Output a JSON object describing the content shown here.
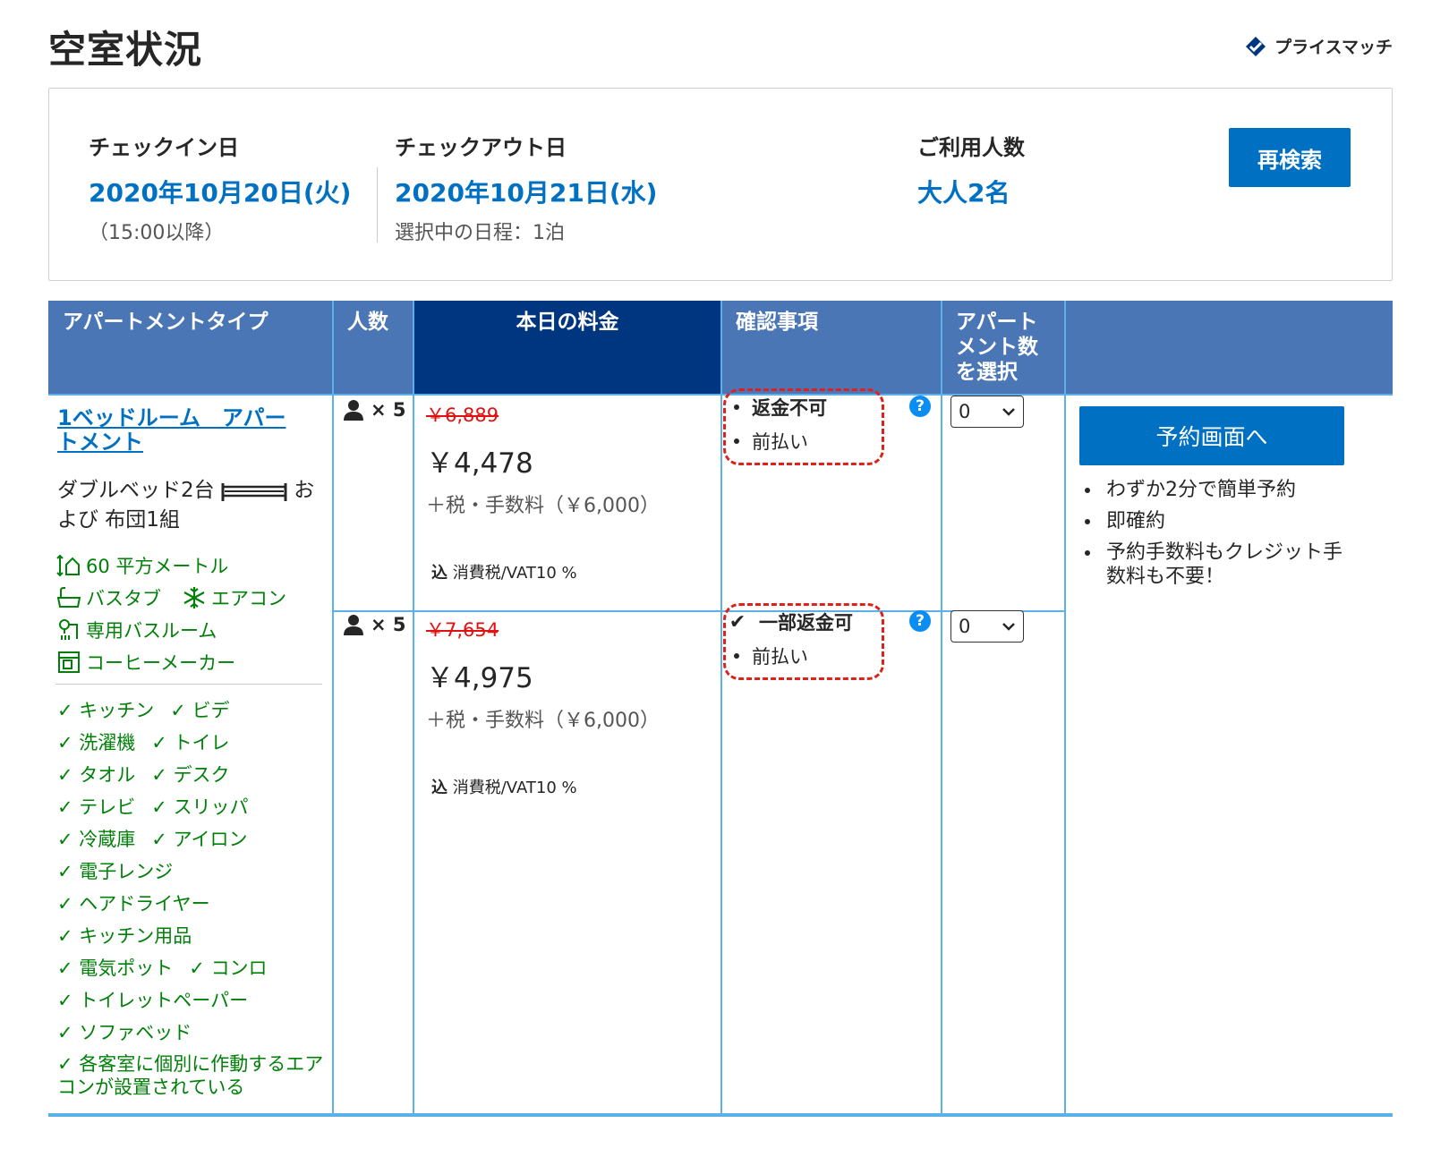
{
  "page_title": "空室状況",
  "price_match_label": "プライスマッチ",
  "search": {
    "checkin_label": "チェックイン日",
    "checkin_date": "2020年10月20日(火)",
    "checkin_note": "（15:00以降）",
    "checkout_label": "チェックアウト日",
    "checkout_date": "2020年10月21日(水)",
    "checkout_note": "選択中の日程：1泊",
    "guests_label": "ご利用人数",
    "guests_value": "大人2名",
    "research_button": "再検索"
  },
  "table_headers": {
    "type": "アパートメントタイプ",
    "guests": "人数",
    "price": "本日の料金",
    "conditions": "確認事項",
    "select_count": "アパートメント数を選択"
  },
  "room": {
    "name": "1ベッドルーム　アパートメント",
    "bed_before": "ダブルベッド2台",
    "bed_after": "および 布団1組",
    "facilities": [
      {
        "label": "60 平方メートル",
        "icon": "room-size-icon"
      },
      {
        "label": "バスタブ",
        "icon": "bathtub-icon"
      },
      {
        "label": "エアコン",
        "icon": "air-conditioning-icon"
      },
      {
        "label": "専用バスルーム",
        "icon": "private-bathroom-icon"
      },
      {
        "label": "コーヒーメーカー",
        "icon": "coffee-maker-icon"
      }
    ],
    "amenities": {
      "row1": [
        "キッチン",
        "ビデ"
      ],
      "row2": [
        "洗濯機",
        "トイレ"
      ],
      "row3": [
        "タオル",
        "デスク"
      ],
      "row4": [
        "テレビ",
        "スリッパ"
      ],
      "row5": [
        "冷蔵庫",
        "アイロン"
      ],
      "row6": [
        "電子レンジ"
      ],
      "row7": [
        "ヘアドライヤー"
      ],
      "row8": [
        "キッチン用品"
      ],
      "row9": [
        "電気ポット",
        "コンロ"
      ],
      "row10": [
        "トイレットペーパー"
      ],
      "row11": [
        "ソファベッド"
      ],
      "row12": [
        "各客室に個別に作動するエアコンが設置されている"
      ]
    }
  },
  "options": [
    {
      "guests": "× 5",
      "old_price": "￥6,889",
      "price": "￥4,478",
      "fee": "＋税・手数料（￥6,000）",
      "tax_prefix": "込",
      "tax": "消費税/VAT10 %",
      "condition1": "返金不可",
      "condition2": "前払い",
      "select_value": "0"
    },
    {
      "guests": "× 5",
      "old_price": "￥7,654",
      "price": "￥4,975",
      "fee": "＋税・手数料（￥6,000）",
      "tax_prefix": "込",
      "tax": "消費税/VAT10 %",
      "condition1": "一部返金可",
      "condition2": "前払い",
      "select_value": "0"
    }
  ],
  "booking": {
    "button": "予約画面へ",
    "benefits": [
      "わずか2分で簡単予約",
      "即確約",
      "予約手数料もクレジット手数料も不要！"
    ]
  },
  "colors": {
    "brand_blue": "#0071c2",
    "header_blue": "#4b76b5",
    "header_dark": "#003580",
    "green": "#008009",
    "strike_red": "#e21111",
    "annotation_red": "#e0201b"
  }
}
